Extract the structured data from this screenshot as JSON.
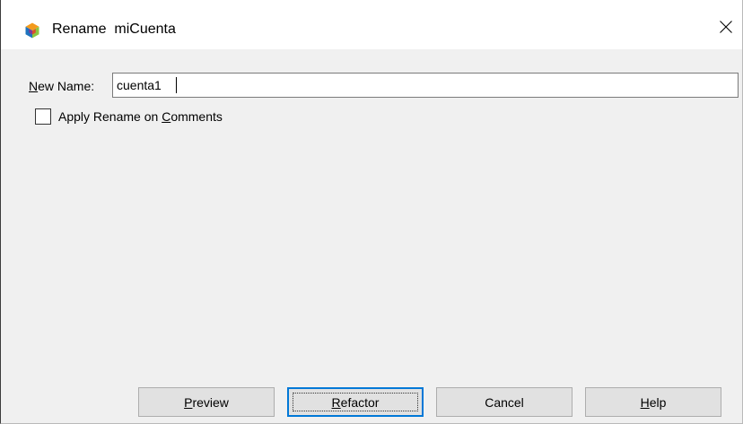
{
  "window": {
    "title_prefix": "Rename",
    "title_target": "miCuenta",
    "app_icon": "netbeans-cube-icon",
    "close_icon": "close-icon"
  },
  "form": {
    "new_name": {
      "label_access": "N",
      "label_rest": "ew Name:",
      "value": "cuenta1"
    },
    "apply_on_comments": {
      "label_before": "Apply Rename on ",
      "label_access": "C",
      "label_after": "omments",
      "checked": false
    }
  },
  "buttons": {
    "preview": {
      "access": "P",
      "rest": "review"
    },
    "refactor": {
      "access": "R",
      "rest": "efactor"
    },
    "cancel": {
      "label": "Cancel"
    },
    "help": {
      "access": "H",
      "rest": "elp"
    }
  },
  "colors": {
    "dialog_bg": "#f0f0f0",
    "titlebar_bg": "#ffffff",
    "default_button_border": "#0078d7",
    "icon_blue": "#1e73be",
    "icon_orange": "#f39a1c",
    "icon_green": "#8cc63f",
    "icon_purple": "#7d3c98"
  }
}
